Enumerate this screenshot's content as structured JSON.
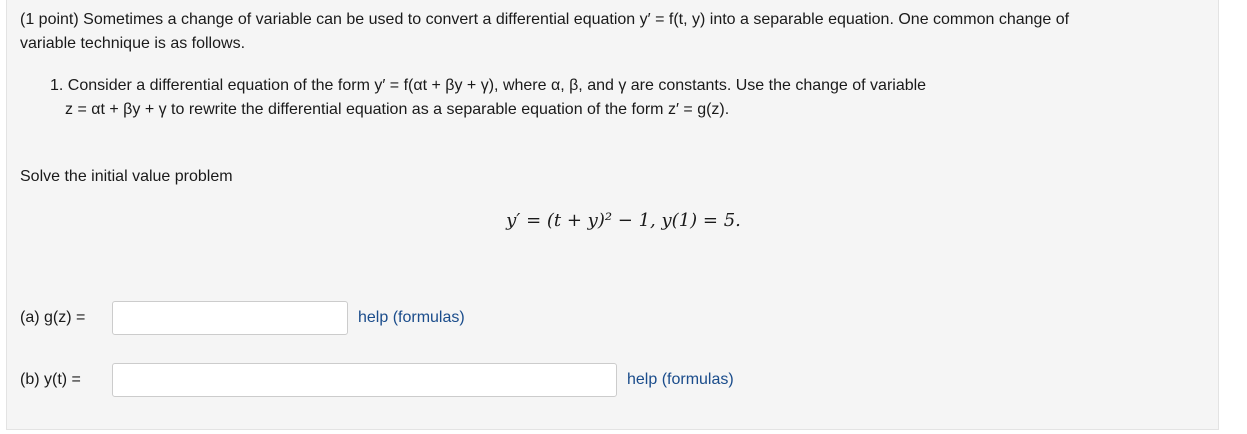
{
  "problem": {
    "intro_line1": "(1 point) Sometimes a change of variable can be used to convert a differential equation y′ = f(t, y) into a separable equation. One common change of",
    "intro_line2": "variable technique is as follows.",
    "item_line1": "1. Consider a differential equation of the form y′ = f(αt + βy + γ), where α, β, and γ are constants. Use the change of variable",
    "item_line2": "z = αt + βy + γ to rewrite the differential equation as a separable equation of the form z′ = g(z).",
    "solve_text": "Solve the initial value problem",
    "ivp": "y′ = (t + y)² − 1,   y(1) = 5."
  },
  "answers": {
    "a": {
      "label": "(a) g(z) =",
      "value": "",
      "help": "help (formulas)"
    },
    "b": {
      "label": "(b) y(t) =",
      "value": "",
      "help": "help (formulas)"
    }
  }
}
